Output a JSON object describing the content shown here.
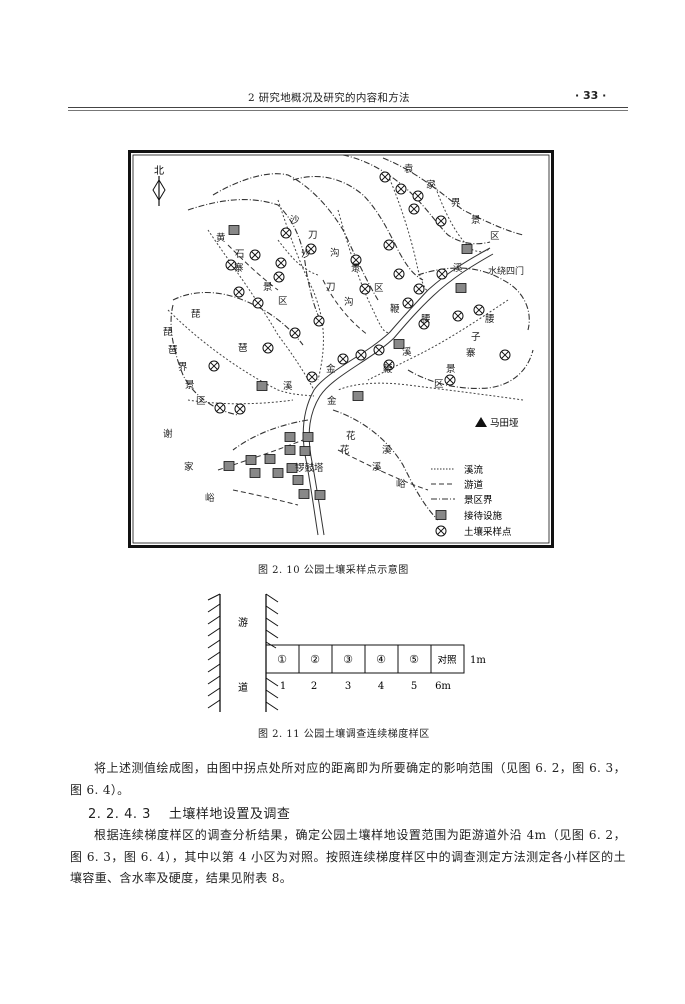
{
  "header": {
    "chapter": "2   研究地概况及研究的内容和方法",
    "page_number": "· 33 ·"
  },
  "figure_2_10": {
    "caption": "图 2. 10    公园土壤采样点示意图",
    "north": "北",
    "labels": {
      "yuanjiajie": [
        "袁",
        "家",
        "界",
        "景",
        "区"
      ],
      "shadaogou_a": [
        "沙",
        "刀",
        "沟",
        "景",
        "区"
      ],
      "shadaogou_b": [
        "沙",
        "刀",
        "沟"
      ],
      "huangshizhai": [
        "黄",
        "石",
        "寨",
        "景",
        "区"
      ],
      "shuiraosimen": "水绕四门",
      "jinbianxi": [
        "金",
        "鞭",
        "溪"
      ],
      "jinbianxi2": [
        "金",
        "鞭",
        "溪"
      ],
      "yaozizhai": [
        "腰",
        "子",
        "寨",
        "景",
        "区"
      ],
      "pipajie": [
        "琵",
        "琶",
        "界",
        "景",
        "区"
      ],
      "pipaxi": [
        "琶",
        "溪"
      ],
      "matianya": "马田垭",
      "xiejiayu": [
        "谢",
        "家",
        "峪"
      ],
      "huaxi": [
        "花",
        "溪"
      ],
      "huaxiyu": [
        "花",
        "溪",
        "峪"
      ],
      "luoguta": "锣鼓塔"
    },
    "legend": [
      "溪流",
      "游道",
      "景区界",
      "接待设施",
      "土壤采样点"
    ]
  },
  "figure_2_11": {
    "caption": "图 2. 11    公园土壤调查连续梯度样区",
    "side_label": [
      "游",
      "道"
    ],
    "plots": [
      "①",
      "②",
      "③",
      "④",
      "⑤",
      "对照"
    ],
    "height_label": "1m",
    "distance_ticks": [
      "1",
      "2",
      "3",
      "4",
      "5",
      "6m"
    ]
  },
  "body": {
    "para1": "将上述测值绘成图，由图中拐点处所对应的距离即为所要确定的影响范围（见图 6. 2，图 6. 3，图 6. 4）。",
    "section_number": "2. 2. 4. 3",
    "section_title": "土壤样地设置及调查",
    "para2": "根据连续梯度样区的调查分析结果，确定公园土壤样地设置范围为距游道外沿 4m（见图 6. 2，图 6. 3，图 6. 4），其中以第 4 小区为对照。按照连续梯度样区中的调查测定方法测定各小样区的土壤容重、含水率及硬度，结果见附表 8。"
  }
}
